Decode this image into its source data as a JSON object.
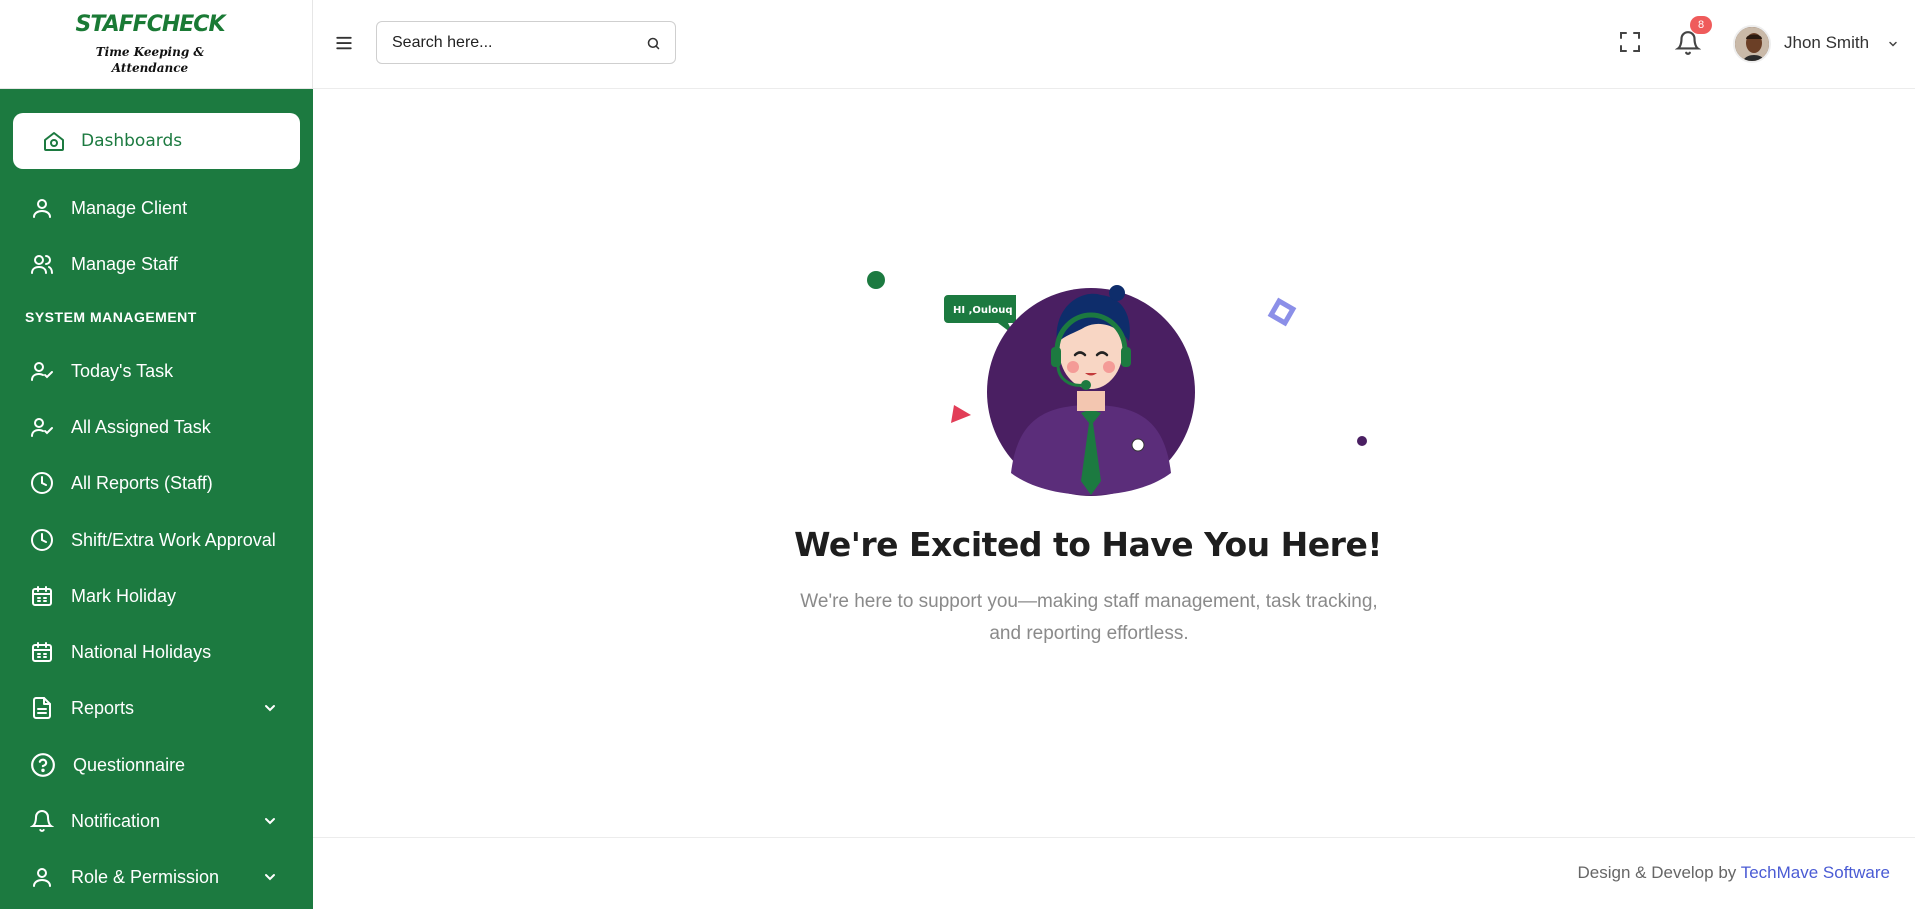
{
  "brand": {
    "name": "STAFFCHECK",
    "tagline_line1": "Time Keeping &",
    "tagline_line2": "Attendance"
  },
  "sidebar": {
    "active": {
      "label": "Dashboards",
      "icon": "home-icon"
    },
    "items": [
      {
        "label": "Manage Client",
        "icon": "user-icon"
      },
      {
        "label": "Manage Staff",
        "icon": "users-icon"
      }
    ],
    "section_title": "SYSTEM MANAGEMENT",
    "system_items": [
      {
        "label": "Today's Task",
        "icon": "user-check-icon"
      },
      {
        "label": "All Assigned Task",
        "icon": "user-check-icon"
      },
      {
        "label": "All Reports (Staff)",
        "icon": "clock-icon"
      },
      {
        "label": "Shift/Extra Work Approval",
        "icon": "clock-icon"
      },
      {
        "label": "Mark Holiday",
        "icon": "calendar-icon"
      },
      {
        "label": "National Holidays",
        "icon": "calendar-icon"
      },
      {
        "label": "Reports",
        "icon": "document-icon",
        "expandable": true
      },
      {
        "label": "Questionnaire",
        "icon": "help-circle-icon"
      },
      {
        "label": "Notification",
        "icon": "bell-icon",
        "expandable": true
      },
      {
        "label": "Role & Permission",
        "icon": "user-icon",
        "expandable": true
      }
    ]
  },
  "header": {
    "search_placeholder": "Search here...",
    "notification_count": "8",
    "user_name": "Jhon Smith"
  },
  "main": {
    "speech_bubble": "HI ,Oulouq",
    "headline": "We're Excited to Have You Here!",
    "subline": "We're here to support you—making staff management, task tracking, and reporting effortless."
  },
  "footer": {
    "text": "Design & Develop by",
    "link": "TechMave Software"
  },
  "colors": {
    "sidebar_bg": "#1c7a40",
    "accent_purple": "#4a1f62",
    "link_blue": "#4a5bd4",
    "badge_red": "#ef5b5b"
  }
}
